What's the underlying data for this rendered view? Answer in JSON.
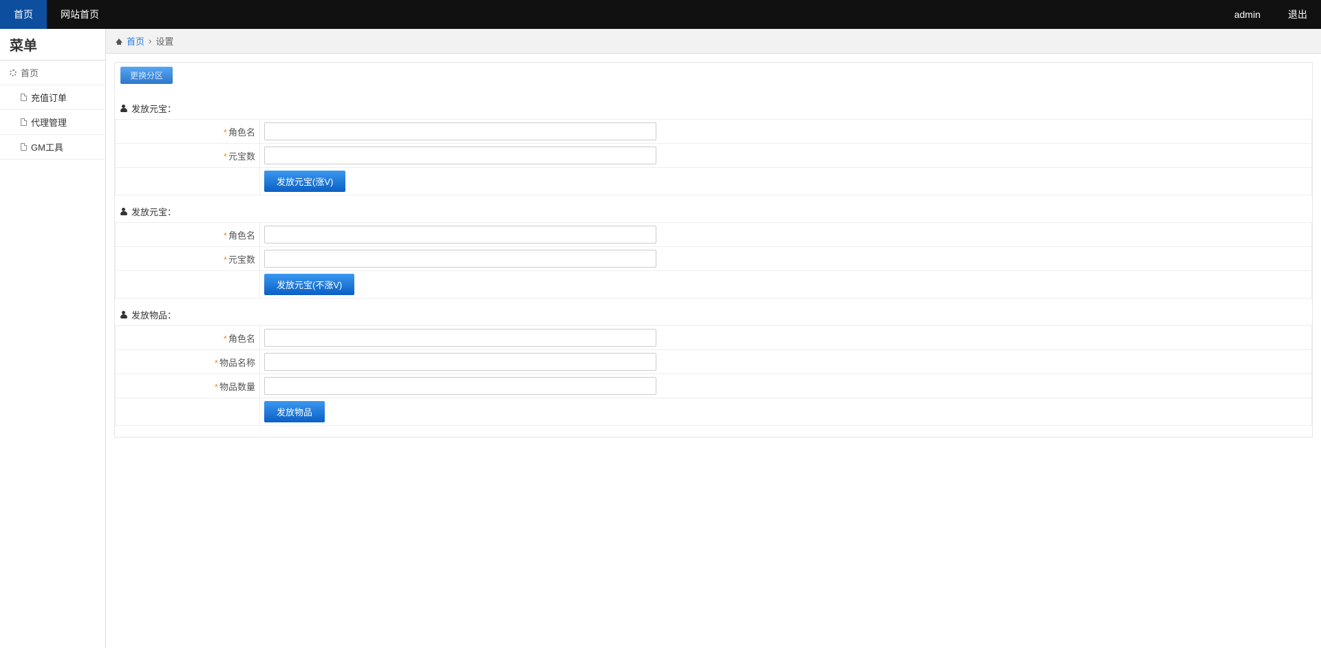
{
  "topnav": {
    "home": "首页",
    "site_home": "网站首页",
    "user": "admin",
    "logout": "退出"
  },
  "sidebar": {
    "title": "菜单",
    "parent": "首页",
    "items": [
      {
        "label": "充值订单"
      },
      {
        "label": "代理管理"
      },
      {
        "label": "GM工具"
      }
    ]
  },
  "breadcrumb": {
    "home": "首页",
    "sep": "›",
    "current": "设置"
  },
  "zone_button": "更换分区",
  "sections": [
    {
      "title": "发放元宝：",
      "fields": [
        {
          "label": "角色名",
          "value": ""
        },
        {
          "label": "元宝数",
          "value": ""
        }
      ],
      "submit": "发放元宝(涨V)"
    },
    {
      "title": "发放元宝：",
      "fields": [
        {
          "label": "角色名",
          "value": ""
        },
        {
          "label": "元宝数",
          "value": ""
        }
      ],
      "submit": "发放元宝(不涨V)"
    },
    {
      "title": "发放物品：",
      "fields": [
        {
          "label": "角色名",
          "value": ""
        },
        {
          "label": "物品名称",
          "value": ""
        },
        {
          "label": "物品数量",
          "value": ""
        }
      ],
      "submit": "发放物品"
    }
  ],
  "required_mark": "*"
}
